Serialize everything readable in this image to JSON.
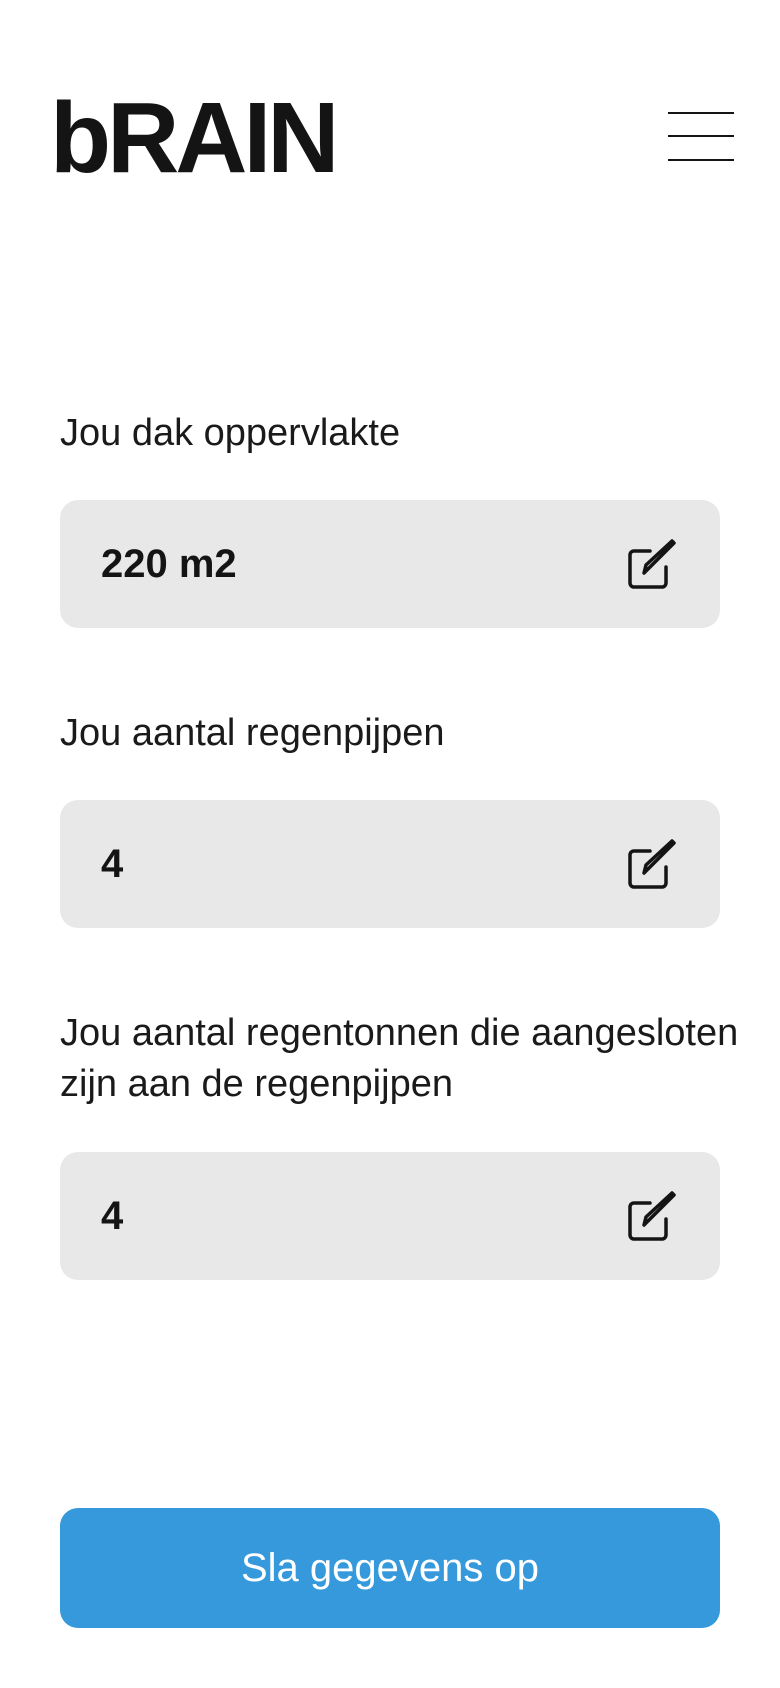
{
  "app": {
    "logo": "bRAIN"
  },
  "header": {
    "menu_icon": "hamburger-menu-icon"
  },
  "fields": [
    {
      "label": "Jou dak oppervlakte",
      "value": "220 m2",
      "icon": "edit-icon"
    },
    {
      "label": "Jou aantal regenpijpen",
      "value": "4",
      "icon": "edit-icon"
    },
    {
      "label": "Jou aantal regentonnen die aangesloten zijn aan de regenpijpen",
      "value": "4",
      "icon": "edit-icon"
    }
  ],
  "actions": {
    "save_label": "Sla gegevens op"
  },
  "colors": {
    "accent": "#3699dc",
    "field_background": "#e8e8e8",
    "text": "#141414"
  }
}
